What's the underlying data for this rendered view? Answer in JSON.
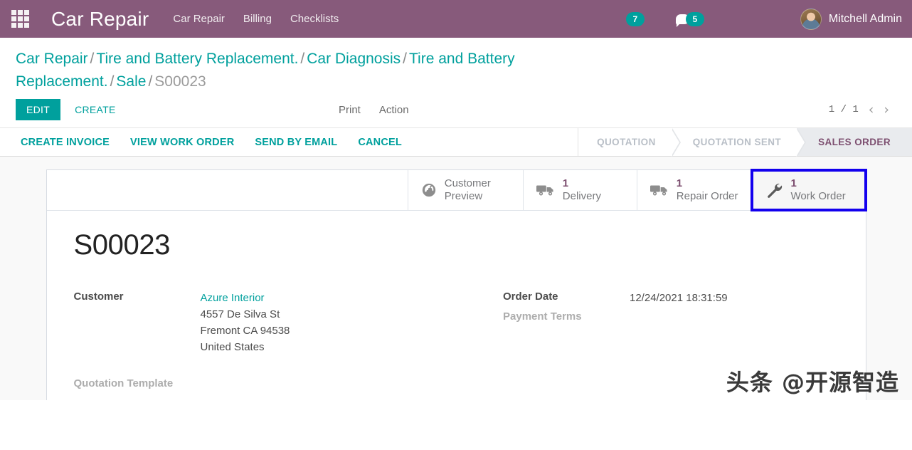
{
  "navbar": {
    "apps_icon": "apps-grid-icon",
    "brand": "Car Repair",
    "menu": [
      {
        "label": "Car Repair"
      },
      {
        "label": "Billing"
      },
      {
        "label": "Checklists"
      }
    ],
    "activity_count": "7",
    "messaging_icon": "chat-bubble-icon",
    "messaging_count": "5",
    "user_name": "Mitchell Admin"
  },
  "breadcrumb": {
    "items": [
      {
        "label": "Car Repair",
        "link": true
      },
      {
        "label": "Tire and Battery Replacement.",
        "link": true
      },
      {
        "label": "Car Diagnosis",
        "link": true
      },
      {
        "label": "Tire and Battery Replacement.",
        "link": true
      },
      {
        "label": "Sale",
        "link": true
      },
      {
        "label": "S00023",
        "link": false
      }
    ],
    "separator": "/"
  },
  "control_panel": {
    "edit_label": "EDIT",
    "create_label": "CREATE",
    "print_label": "Print",
    "action_label": "Action",
    "pager_text": "1 / 1",
    "prev_icon": "chevron-left-icon",
    "next_icon": "chevron-right-icon"
  },
  "object_buttons": [
    {
      "label": "CREATE INVOICE"
    },
    {
      "label": "VIEW WORK ORDER"
    },
    {
      "label": "SEND BY EMAIL"
    },
    {
      "label": "CANCEL"
    }
  ],
  "statusbar": {
    "stages": [
      {
        "label": "QUOTATION",
        "active": false
      },
      {
        "label": "QUOTATION SENT",
        "active": false
      },
      {
        "label": "SALES ORDER",
        "active": true
      }
    ]
  },
  "smart_buttons": [
    {
      "icon": "globe-icon",
      "value": "",
      "label": "Customer Preview",
      "highlighted": false
    },
    {
      "icon": "truck-icon",
      "value": "1",
      "label": "Delivery",
      "highlighted": false
    },
    {
      "icon": "truck-icon",
      "value": "1",
      "label": "Repair Order",
      "highlighted": false
    },
    {
      "icon": "wrench-icon",
      "value": "1",
      "label": "Work Order",
      "highlighted": true
    }
  ],
  "form": {
    "record_title": "S00023",
    "customer_label": "Customer",
    "customer_name": "Azure Interior",
    "customer_address": [
      "4557 De Silva St",
      "Fremont CA 94538",
      "United States"
    ],
    "quotation_template_label": "Quotation Template",
    "quotation_template_value": "",
    "order_date_label": "Order Date",
    "order_date_value": "12/24/2021 18:31:59",
    "payment_terms_label": "Payment Terms",
    "payment_terms_value": ""
  },
  "watermark": "头条 @开源智造",
  "colors": {
    "brand_purple": "#875A7B",
    "accent_teal": "#00A09D",
    "status_active": "#7d4f70",
    "highlight_blue": "#1300ee"
  }
}
